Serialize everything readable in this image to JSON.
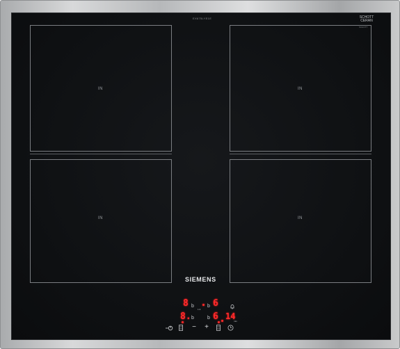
{
  "hob": {
    "model_text": "EX675LYE1E",
    "glass_brand_line1": "SCHOTT",
    "glass_brand_line2": "CERAN",
    "glass_brand_sub": "SCHOTT",
    "brand": "SIEMENS"
  },
  "zones": [
    {
      "mark": "IN"
    },
    {
      "mark": "IN"
    },
    {
      "mark": "IN"
    },
    {
      "mark": "IN"
    }
  ],
  "display": {
    "row1_left_digit": "8",
    "row1_left_b": "b",
    "row1_mid_b": "b",
    "row1_right_digit": "6",
    "row2_left_digit": "8.",
    "row2_left_b": "b",
    "row2_mid_b": "b",
    "row2_right_digit": "6",
    "timer_value": "14",
    "timer_unit": "min",
    "middle_small_label": "1-9"
  },
  "controls": {
    "power_icon": "power-icon",
    "zone_select_icon": "zone-select-icon",
    "minus_label": "−",
    "plus_label": "+",
    "zone_select_right_icon": "zone-select-icon",
    "timer_icon": "timer-icon",
    "bell_icon": "bell-icon"
  },
  "colors": {
    "display_red": "#ff2a2a",
    "glass": "#0e1012",
    "frame": "#c0c2c4"
  }
}
